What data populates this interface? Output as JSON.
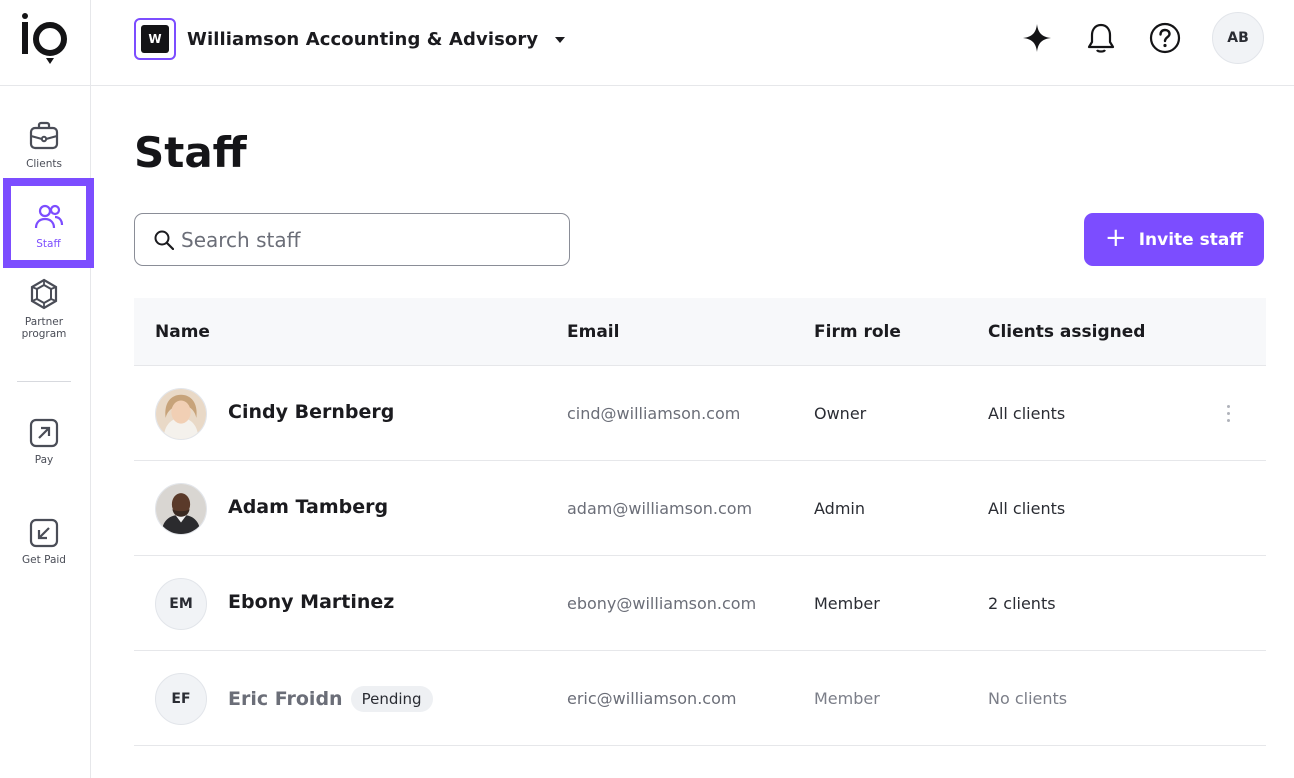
{
  "brand": {
    "logo_text": "io",
    "accent": "#7c4dff"
  },
  "sidebar": {
    "items": [
      {
        "label": "Clients",
        "icon": "briefcase-icon"
      },
      {
        "label": "Staff",
        "icon": "users-icon",
        "active": true
      },
      {
        "label": "Partner program",
        "label_line1": "Partner",
        "label_line2": "program",
        "icon": "gem-icon"
      },
      {
        "label": "Pay",
        "icon": "arrow-up-right-icon"
      },
      {
        "label": "Get Paid",
        "icon": "arrow-down-left-icon"
      }
    ]
  },
  "topbar": {
    "firm_initial": "W",
    "firm_name": "Williamson Accounting & Advisory",
    "actions": [
      "sparkle-icon",
      "bell-icon",
      "help-icon"
    ],
    "user_initials": "AB"
  },
  "page": {
    "title": "Staff",
    "search_placeholder": "Search staff",
    "search_value": "",
    "invite_label": "Invite staff"
  },
  "table": {
    "headers": [
      "Name",
      "Email",
      "Firm role",
      "Clients assigned"
    ],
    "rows": [
      {
        "name": "Cindy Bernberg",
        "avatar": "photo",
        "email": "cind@williamson.com",
        "role": "Owner",
        "clients": "All clients",
        "pending": false
      },
      {
        "name": "Adam Tamberg",
        "avatar": "photo",
        "email": "adam@williamson.com",
        "role": "Admin",
        "clients": "All clients",
        "pending": false
      },
      {
        "name": "Ebony Martinez",
        "initials": "EM",
        "email": "ebony@williamson.com",
        "role": "Member",
        "clients": "2 clients",
        "pending": false
      },
      {
        "name": "Eric Froidn",
        "initials": "EF",
        "email": "eric@williamson.com",
        "role": "Member",
        "clients": "No clients",
        "pending": true,
        "badge": "Pending"
      }
    ]
  }
}
